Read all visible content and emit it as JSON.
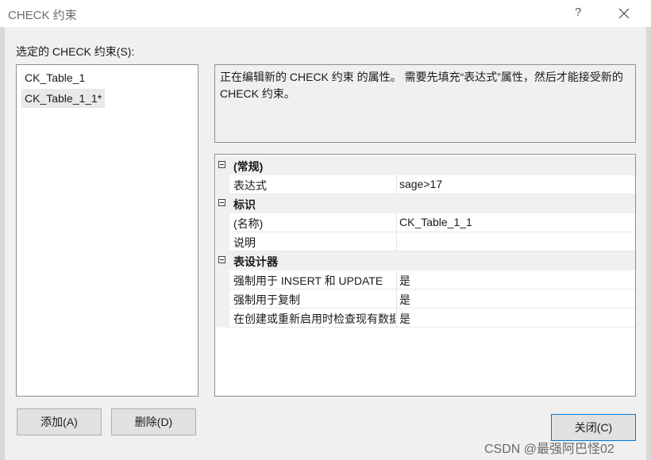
{
  "window": {
    "title": "CHECK 约束",
    "help": "?"
  },
  "selected_label": "选定的 CHECK 约束(S):",
  "constraints": [
    "CK_Table_1",
    "CK_Table_1_1*"
  ],
  "description": "正在编辑新的 CHECK 约束 的属性。  需要先填充“表达式”属性，然后才能接受新的 CHECK 约束。",
  "grid": {
    "cat1": "(常规)",
    "expression_name": "表达式",
    "expression_value": "sage>17",
    "cat2": "标识",
    "name_name": "(名称)",
    "name_value": "CK_Table_1_1",
    "desc_name": "说明",
    "desc_value": "",
    "cat3": "表设计器",
    "enforce_insert_name": "强制用于 INSERT 和 UPDATE",
    "enforce_insert_value": "是",
    "enforce_repl_name": "强制用于复制",
    "enforce_repl_value": "是",
    "check_existing_name": "在创建或重新启用时检查现有数据",
    "check_existing_value": "是"
  },
  "buttons": {
    "add": "添加(A)",
    "delete": "删除(D)",
    "close": "关闭(C)"
  },
  "watermark": "CSDN @最强阿巴怪02"
}
